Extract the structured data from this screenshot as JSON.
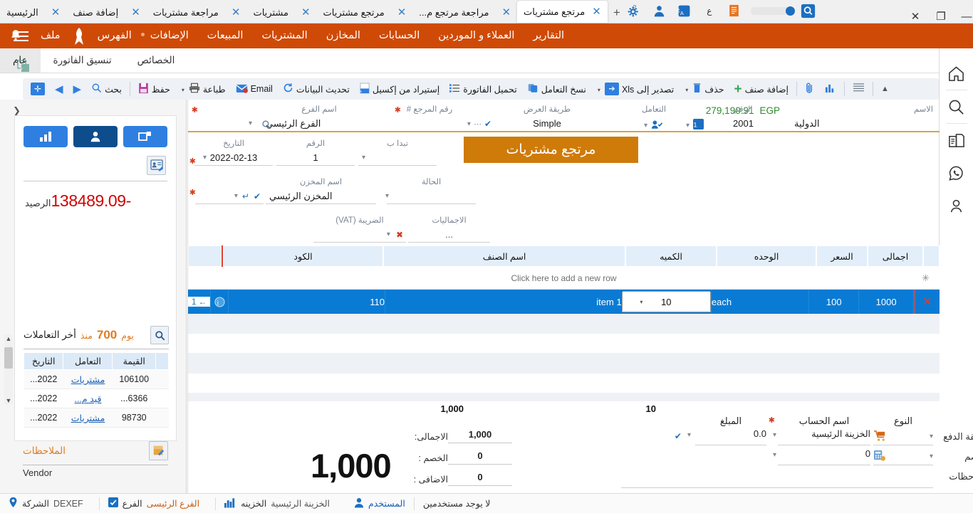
{
  "window": {
    "tabs": [
      {
        "label": "الرئيسية",
        "active": false
      },
      {
        "label": "إضافة صنف",
        "active": false
      },
      {
        "label": "مراجعة مشتريات",
        "active": false
      },
      {
        "label": "مشتريات",
        "active": false
      },
      {
        "label": "مرتجع مشتريات",
        "active": false
      },
      {
        "label": "مراجعة مرتجع م...",
        "active": false
      },
      {
        "label": "مرتجع مشتريات",
        "active": true
      }
    ],
    "new_tab_label": "+",
    "close_label": "✕",
    "controls": {
      "minimize": "—",
      "restore": "❐",
      "close": "✕"
    }
  },
  "menubar": {
    "items": [
      "ملف",
      "الفهرس",
      "الإضافات",
      "المبيعات",
      "المشتريات",
      "المخازن",
      "الحسابات",
      "العملاء و الموردين",
      "التقارير"
    ]
  },
  "subtabs": [
    {
      "label": "عام",
      "active": true
    },
    {
      "label": "تنسيق الفاتورة",
      "active": false
    },
    {
      "label": "الخصائص",
      "active": false
    }
  ],
  "toolbar": {
    "buttons": [
      {
        "label": "",
        "icon": "add-record-icon",
        "name": "add-record-button"
      },
      {
        "label": "",
        "icon": "next-arrow-icon",
        "name": "next-record-button"
      },
      {
        "label": "",
        "icon": "prev-arrow-icon",
        "name": "prev-record-button"
      },
      {
        "label": "بحث",
        "icon": "search-icon",
        "name": "search-button"
      },
      {
        "label": "حفظ",
        "icon": "save-icon",
        "name": "save-button"
      },
      {
        "label": "طباعة",
        "icon": "print-icon",
        "name": "print-button"
      },
      {
        "label": "Email",
        "icon": "email-icon",
        "name": "email-button"
      },
      {
        "label": "تحديث البيانات",
        "icon": "refresh-icon",
        "name": "refresh-data-button"
      },
      {
        "label": "إستيراد من إكسيل",
        "icon": "excel-import-icon",
        "name": "import-excel-button"
      },
      {
        "label": "تحميل الفاتورة",
        "icon": "list-icon",
        "name": "load-invoice-button"
      },
      {
        "label": "نسخ التعامل",
        "icon": "copy-icon",
        "name": "copy-transaction-button"
      },
      {
        "label": "تصدير إلى Xls",
        "icon": "export-icon",
        "name": "export-xls-button"
      },
      {
        "label": "حذف",
        "icon": "delete-icon",
        "name": "delete-button"
      },
      {
        "label": "إضافة صنف",
        "icon": "plus-icon",
        "name": "add-item-button"
      },
      {
        "label": "",
        "icon": "attachment-icon",
        "name": "attachment-button"
      },
      {
        "label": "",
        "icon": "chart-icon",
        "name": "chart-button"
      },
      {
        "label": "",
        "icon": "grid-icon",
        "name": "grid-view-button"
      },
      {
        "label": "",
        "icon": "chevron-up-icon",
        "name": "collapse-toolbar-button"
      }
    ]
  },
  "rail": {
    "icons": [
      "home-icon",
      "search-icon",
      "documents-icon",
      "whatsapp-icon",
      "person-icon"
    ]
  },
  "left_panel": {
    "toggle_buttons": [
      "chart-bars-icon",
      "person-icon",
      "windows-icon"
    ],
    "edit_card_icon": "edit-contact-icon",
    "balance_label": "الرصيد",
    "balance_value": "-138489.09",
    "balance_color": "#d10000",
    "transactions": {
      "title": "أخر التعاملات",
      "since_label": "منذ",
      "days_value": "700",
      "days_unit": "يوم",
      "search_icon": "search-icon",
      "columns": [
        "القيمة",
        "التعامل",
        "التاريخ"
      ],
      "rows": [
        {
          "value": "106100",
          "type": "مشتريات",
          "date": "2022..."
        },
        {
          "value": "6366...",
          "type": "قيد م...",
          "date": "2022..."
        },
        {
          "value": "98730",
          "type": "مشتريات",
          "date": "2022..."
        }
      ]
    },
    "notes": {
      "title": "الملاحظات",
      "icon": "note-add-icon",
      "value": "Vendor"
    }
  },
  "form": {
    "title_banner": "مرتجع مشتريات",
    "currency_amount": "279,190.91",
    "currency_code": "EGP",
    "fields": {
      "name_label": "الاسم",
      "name_value": "الدولية",
      "number_label": "الرقم",
      "number_value": "2001",
      "deal_label": "التعامل",
      "deal_value": "",
      "display_method_label": "طريقة العرض",
      "display_method_value": "Simple",
      "reference_label": "رقم المرجع #",
      "reference_value": "",
      "branch_label": "اسم الفرع",
      "branch_value": "الفرع الرئيسي",
      "starts_with_label": "تبدا ب",
      "starts_with_value": "",
      "doc_number_label": "الرقم",
      "doc_number_value": "1",
      "date_label": "التاريخ",
      "date_value": "2022-02-13",
      "status_label": "الحالة",
      "status_value": "",
      "store_label": "اسم المخزن",
      "store_value": "المخزن الرئيسي",
      "totals_label": "الاجماليات",
      "totals_value": "...",
      "vat_label": "الضريبة (VAT)",
      "vat_value": ""
    },
    "grid": {
      "columns": [
        "اجمالى",
        "السعر",
        "الوحده",
        "الكميه",
        "اسم الصنف",
        "الكود"
      ],
      "add_row_hint": "Click here to add a new row",
      "rows": [
        {
          "row_number": "1",
          "code": "110",
          "item_name": "item 1",
          "qty": "10",
          "unit": "each",
          "price": "100",
          "total": "1000",
          "delete_icon": "delete-x-icon",
          "info_icon": "info-icon"
        }
      ]
    },
    "footer_totals": {
      "qty_sum": "10",
      "amount_sum": "1,000",
      "grand_total": "1,000",
      "lines": [
        {
          "label": "الاجمالى:",
          "value": "1,000"
        },
        {
          "label": "الخصم :",
          "value": "0"
        },
        {
          "label": "الاضافى :",
          "value": "0"
        }
      ]
    },
    "payment": {
      "type_label": "النوع",
      "account_label": "اسم الحساب",
      "amount_label": "المبلغ",
      "payment_method_label": "طريقة الدفع",
      "payment_account_value": "الخزينة الرئيسية",
      "payment_amount_value": "0.0",
      "discount_label": "الخصم",
      "discount_value": "0",
      "notes_label": "الملاحظات",
      "notes_value": "",
      "type_icon_1": "cart-icon",
      "type_icon_2": "calculator-icon"
    }
  },
  "status_bar": {
    "company_label": "الشركة",
    "company_value": "DEXEF",
    "branch_label": "الفرع",
    "branch_value": "الفرع الرئيسى",
    "treasury_label": "الخزينه",
    "treasury_value": "الخزينة الرئيسية",
    "user_label": "المستخدم",
    "user_value": "لا يوجد مستخدمين",
    "location_icon": "location-pin-icon",
    "branch_icon": "check-box-icon",
    "treasury_icon": "bars-icon",
    "user_icon": "person-icon"
  }
}
